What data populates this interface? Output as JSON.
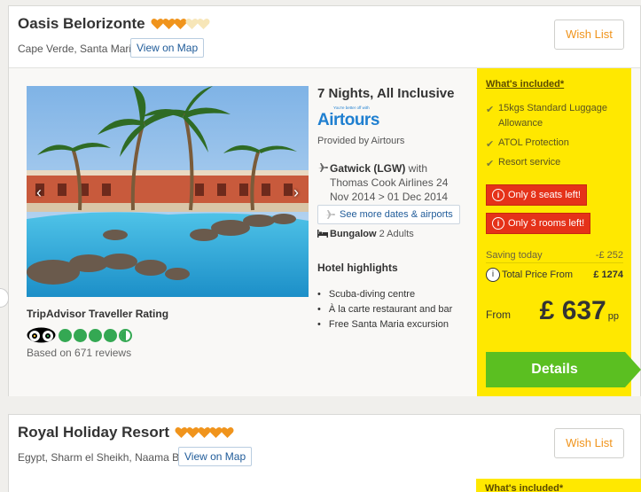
{
  "colors": {
    "accent_orange": "#f0941c",
    "included_yellow": "#ffe800",
    "alert_red": "#e53219",
    "details_green": "#5bbf21",
    "link_blue": "#1f5b99",
    "tripadvisor_green": "#34a853"
  },
  "hotels": [
    {
      "name": "Oasis Belorizonte",
      "rating_hearts": 5,
      "rating_filled": 3,
      "location": "Cape Verde, Santa Maria",
      "map_label": "View on Map",
      "wish_label": "Wish List",
      "photo_icons": {
        "prev": "chevron-left-icon",
        "next": "chevron-right-icon"
      },
      "duration": "7 Nights, All Inclusive",
      "operator_logo": "Airtours",
      "operator_tagline": "You're better off with",
      "provided_by": "Provided by Airtours",
      "flight": {
        "airport": "Gatwick (LGW)",
        "details": " with Thomas Cook Airlines 24 Nov 2014 > 01 Dec 2014"
      },
      "more_dates_label": "See more dates & airports",
      "room": {
        "type": "Bungalow",
        "guests": " 2 Adults"
      },
      "highlights_title": "Hotel highlights",
      "highlights": [
        "Scuba-diving centre",
        "À la carte restaurant and bar",
        "Free Santa Maria excursion"
      ],
      "tripadvisor": {
        "title": "TripAdvisor Traveller Rating",
        "rating": 4.5,
        "max": 5,
        "reviews": "Based on 671 reviews"
      },
      "included": {
        "title": "What's included*",
        "items": [
          "15kgs Standard Luggage Allowance",
          "ATOL Protection",
          "Resort service"
        ]
      },
      "alerts": {
        "seats": "Only 8 seats left!",
        "rooms": "Only 3 rooms left!"
      },
      "saving_label": "Saving today",
      "saving_amount": "-£ 252",
      "total_label": "Total Price From",
      "total_amount": "£ 1274",
      "from_label": "From",
      "price": "£ 637",
      "price_unit": "pp",
      "details_label": "Details"
    },
    {
      "name": "Royal Holiday Resort",
      "rating_hearts": 5,
      "rating_filled": 5,
      "location": "Egypt, Sharm el Sheikh, Naama Bay",
      "map_label": "View on Map",
      "wish_label": "Wish List",
      "included_title": "What's included*"
    }
  ]
}
